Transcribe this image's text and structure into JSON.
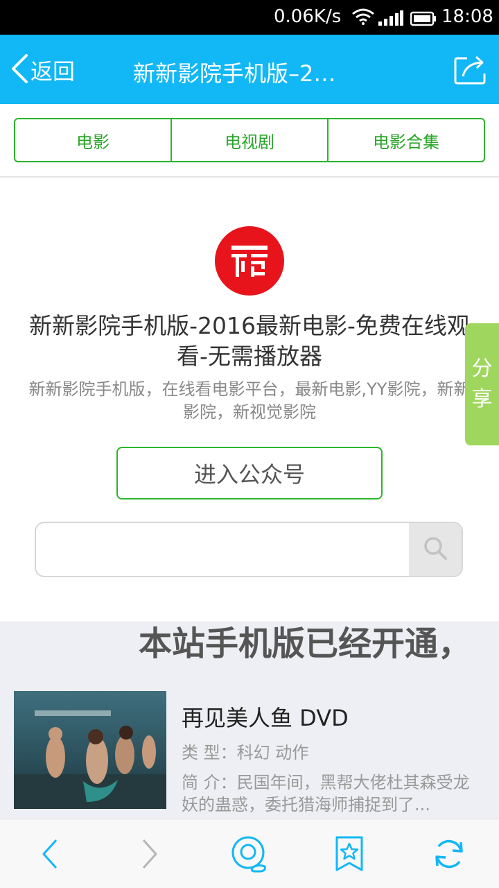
{
  "status_bar": {
    "net_speed": "0.06K/s",
    "time": "18:08",
    "icons": [
      "wifi-icon",
      "signal-icon",
      "battery-icon"
    ]
  },
  "header": {
    "back_label": "返回",
    "title": "新新影院手机版–2…",
    "icons": [
      "back-chevron-icon",
      "share-export-icon"
    ]
  },
  "tabs": [
    {
      "label": "电影"
    },
    {
      "label": "电视剧"
    },
    {
      "label": "电影合集"
    }
  ],
  "profile": {
    "logo_icon": "brand-logo-icon",
    "title": "新新影院手机版-2016最新电影-免费在线观看-无需播放器",
    "description": "新新影院手机版，在线看电影平台，最新电影,YY影院，新新影院，新视觉影院",
    "follow_button": "进入公众号"
  },
  "search": {
    "placeholder": "",
    "icon": "search-icon"
  },
  "side_share": {
    "chars": [
      "分",
      "享"
    ]
  },
  "banner": {
    "marquee": "本站手机版已经开通，"
  },
  "movie": {
    "title": "再见美人鱼 DVD",
    "type": "类 型：科幻 动作",
    "description": "简 介：民国年间，黑帮大佬杜其森受龙妖的蛊惑，委托猎海师捕捉到了...",
    "thumb_title": "再见美人鱼"
  },
  "bottom_nav": {
    "icons": [
      "back-arrow-icon",
      "forward-arrow-icon",
      "cloud-search-icon",
      "bookmark-star-icon",
      "refresh-icon"
    ]
  },
  "colors": {
    "header_blue": "#12b7f5",
    "tab_green": "#2bb52b",
    "logo_red": "#e8141c",
    "share_green": "#9fd65d",
    "nav_blue": "#12b7f5"
  }
}
